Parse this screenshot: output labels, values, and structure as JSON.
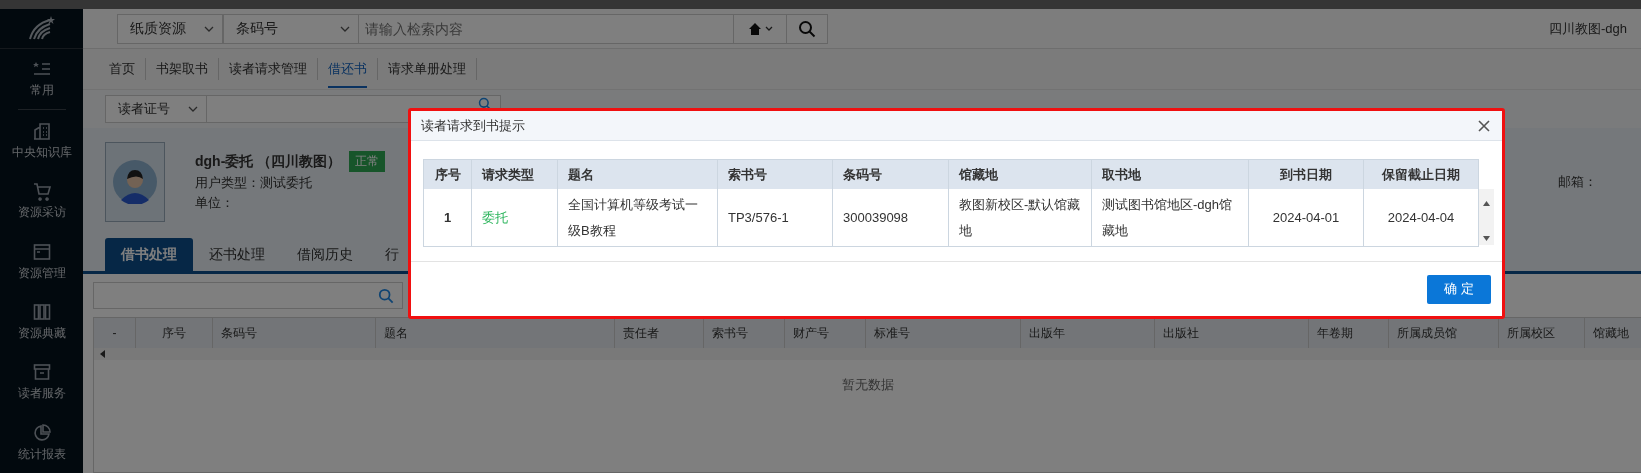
{
  "sidebar": {
    "items": [
      {
        "label": "常用"
      },
      {
        "label": "中央知识库"
      },
      {
        "label": "资源采访"
      },
      {
        "label": "资源管理"
      },
      {
        "label": "资源典藏"
      },
      {
        "label": "读者服务"
      },
      {
        "label": "统计报表"
      }
    ]
  },
  "search_bar": {
    "resource_type": "纸质资源",
    "field": "条码号",
    "placeholder": "请输入检索内容"
  },
  "user_label": "四川教图-dgh",
  "nav_tabs": [
    {
      "label": "首页",
      "selected": false
    },
    {
      "label": "书架取书",
      "selected": false
    },
    {
      "label": "读者请求管理",
      "selected": false
    },
    {
      "label": "借还书",
      "selected": true
    },
    {
      "label": "请求单册处理",
      "selected": false
    }
  ],
  "reader_lookup": {
    "field": "读者证号"
  },
  "reader": {
    "name": "dgh-委托 （四川教图）",
    "status": "正常",
    "user_type": "用户类型：测试委托",
    "unit": "单位：",
    "email": "邮箱："
  },
  "loan_tabs": [
    {
      "label": "借书处理",
      "selected": true
    },
    {
      "label": "还书处理",
      "selected": false
    },
    {
      "label": "借阅历史",
      "selected": false
    },
    {
      "label": "行",
      "selected": false
    }
  ],
  "loan_table": {
    "columns": [
      "-",
      "序号",
      "条码号",
      "题名",
      "责任者",
      "索书号",
      "财产号",
      "标准号",
      "出版年",
      "出版社",
      "年卷期",
      "所属成员馆",
      "所属校区",
      "馆藏地"
    ],
    "empty_text": "暂无数据"
  },
  "dialog": {
    "title": "读者请求到书提示",
    "columns": [
      "序号",
      "请求类型",
      "题名",
      "索书号",
      "条码号",
      "馆藏地",
      "取书地",
      "到书日期",
      "保留截止日期"
    ],
    "rows": [
      [
        "1",
        "委托",
        "全国计算机等级考试一级B教程",
        "TP3/576-1",
        "300039098",
        "教图新校区-默认馆藏地",
        "测试图书馆地区-dgh馆藏地",
        "2024-04-01",
        "2024-04-04"
      ]
    ],
    "confirm": "确 定"
  }
}
